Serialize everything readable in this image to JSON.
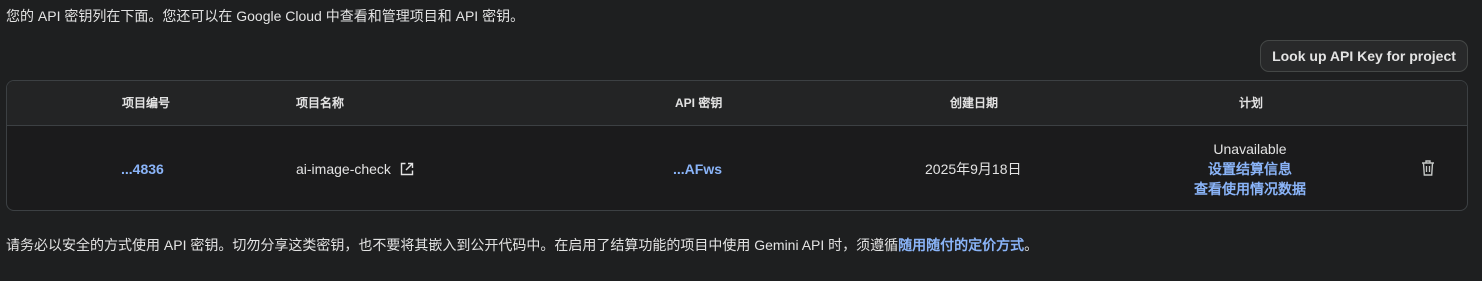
{
  "intro_text": "您的 API 密钥列在下面。您还可以在 Google Cloud 中查看和管理项目和 API 密钥。",
  "lookup_button_label": "Look up API Key for project",
  "table": {
    "headers": {
      "project_number": "项目编号",
      "project_name": "项目名称",
      "api_key": "API 密钥",
      "created_date": "创建日期",
      "plan": "计划"
    },
    "rows": [
      {
        "project_number": "...4836",
        "project_name": "ai-image-check",
        "api_key": "...AFws",
        "created_date": "2025年9月18日",
        "plan_status": "Unavailable",
        "plan_setup_billing": "设置结算信息",
        "plan_view_usage": "查看使用情况数据"
      }
    ]
  },
  "footer": {
    "text_before_link": "请务必以安全的方式使用 API 密钥。切勿分享这类密钥，也不要将其嵌入到公开代码中。在启用了结算功能的项目中使用 Gemini API 时，须遵循",
    "link_text": "随用随付的定价方式",
    "text_after_link": "。"
  },
  "icons": {
    "external_link": "external-link-icon",
    "delete": "trash-icon"
  },
  "colors": {
    "background": "#1e1f20",
    "link": "#8ab4f8",
    "text": "#e3e3e3"
  }
}
